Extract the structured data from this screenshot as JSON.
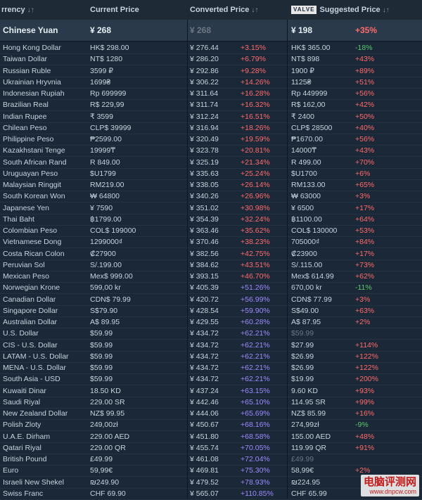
{
  "header": {
    "col_currency": "rrency",
    "col_current": "Current Price",
    "col_converted": "Converted Price",
    "valve_badge": "VALVE",
    "col_suggested": "Suggested Price",
    "sort_glyph": "↓↑"
  },
  "highlight": {
    "currency": "Chinese Yuan",
    "current": "¥ 268",
    "converted": "¥ 268",
    "suggested": "¥ 198",
    "suggested_pct": "+35%"
  },
  "rows": [
    {
      "currency": "Hong Kong Dollar",
      "current": "HK$ 298.00",
      "converted": "¥ 276.44",
      "conv_pct": "+3.15%",
      "suggested": "HK$ 365.00",
      "sugg_pct": "-18%"
    },
    {
      "currency": "Taiwan Dollar",
      "current": "NT$ 1280",
      "converted": "¥ 286.20",
      "conv_pct": "+6.79%",
      "suggested": "NT$ 898",
      "sugg_pct": "+43%"
    },
    {
      "currency": "Russian Ruble",
      "current": "3599 ₽",
      "converted": "¥ 292.86",
      "conv_pct": "+9.28%",
      "suggested": "1900 ₽",
      "sugg_pct": "+89%"
    },
    {
      "currency": "Ukrainian Hryvnia",
      "current": "1699₴",
      "converted": "¥ 306.22",
      "conv_pct": "+14.26%",
      "suggested": "1125₴",
      "sugg_pct": "+51%"
    },
    {
      "currency": "Indonesian Rupiah",
      "current": "Rp 699999",
      "converted": "¥ 311.64",
      "conv_pct": "+16.28%",
      "suggested": "Rp 449999",
      "sugg_pct": "+56%"
    },
    {
      "currency": "Brazilian Real",
      "current": "R$ 229,99",
      "converted": "¥ 311.74",
      "conv_pct": "+16.32%",
      "suggested": "R$ 162,00",
      "sugg_pct": "+42%"
    },
    {
      "currency": "Indian Rupee",
      "current": "₹ 3599",
      "converted": "¥ 312.24",
      "conv_pct": "+16.51%",
      "suggested": "₹ 2400",
      "sugg_pct": "+50%"
    },
    {
      "currency": "Chilean Peso",
      "current": "CLP$ 39999",
      "converted": "¥ 316.94",
      "conv_pct": "+18.26%",
      "suggested": "CLP$ 28500",
      "sugg_pct": "+40%"
    },
    {
      "currency": "Philippine Peso",
      "current": "₱2599.00",
      "converted": "¥ 320.49",
      "conv_pct": "+19.59%",
      "suggested": "₱1670.00",
      "sugg_pct": "+56%"
    },
    {
      "currency": "Kazakhstani Tenge",
      "current": "19999₸",
      "converted": "¥ 323.78",
      "conv_pct": "+20.81%",
      "suggested": "14000₸",
      "sugg_pct": "+43%"
    },
    {
      "currency": "South African Rand",
      "current": "R 849.00",
      "converted": "¥ 325.19",
      "conv_pct": "+21.34%",
      "suggested": "R 499.00",
      "sugg_pct": "+70%"
    },
    {
      "currency": "Uruguayan Peso",
      "current": "$U1799",
      "converted": "¥ 335.63",
      "conv_pct": "+25.24%",
      "suggested": "$U1700",
      "sugg_pct": "+6%"
    },
    {
      "currency": "Malaysian Ringgit",
      "current": "RM219.00",
      "converted": "¥ 338.05",
      "conv_pct": "+26.14%",
      "suggested": "RM133.00",
      "sugg_pct": "+65%"
    },
    {
      "currency": "South Korean Won",
      "current": "₩ 64800",
      "converted": "¥ 340.26",
      "conv_pct": "+26.96%",
      "suggested": "₩ 63000",
      "sugg_pct": "+3%"
    },
    {
      "currency": "Japanese Yen",
      "current": "¥ 7590",
      "converted": "¥ 351.02",
      "conv_pct": "+30.98%",
      "suggested": "¥ 6500",
      "sugg_pct": "+17%"
    },
    {
      "currency": "Thai Baht",
      "current": "฿1799.00",
      "converted": "¥ 354.39",
      "conv_pct": "+32.24%",
      "suggested": "฿1100.00",
      "sugg_pct": "+64%"
    },
    {
      "currency": "Colombian Peso",
      "current": "COL$ 199000",
      "converted": "¥ 363.46",
      "conv_pct": "+35.62%",
      "suggested": "COL$ 130000",
      "sugg_pct": "+53%"
    },
    {
      "currency": "Vietnamese Dong",
      "current": "1299000₫",
      "converted": "¥ 370.46",
      "conv_pct": "+38.23%",
      "suggested": "705000₫",
      "sugg_pct": "+84%"
    },
    {
      "currency": "Costa Rican Colon",
      "current": "₡27900",
      "converted": "¥ 382.56",
      "conv_pct": "+42.75%",
      "suggested": "₡23900",
      "sugg_pct": "+17%"
    },
    {
      "currency": "Peruvian Sol",
      "current": "S/.199.00",
      "converted": "¥ 384.62",
      "conv_pct": "+43.51%",
      "suggested": "S/.115.00",
      "sugg_pct": "+73%"
    },
    {
      "currency": "Mexican Peso",
      "current": "Mex$ 999.00",
      "converted": "¥ 393.15",
      "conv_pct": "+46.70%",
      "suggested": "Mex$ 614.99",
      "sugg_pct": "+62%"
    },
    {
      "currency": "Norwegian Krone",
      "current": "599,00 kr",
      "converted": "¥ 405.39",
      "conv_pct": "+51.26%",
      "suggested": "670,00 kr",
      "sugg_pct": "-11%"
    },
    {
      "currency": "Canadian Dollar",
      "current": "CDN$ 79.99",
      "converted": "¥ 420.72",
      "conv_pct": "+56.99%",
      "suggested": "CDN$ 77.99",
      "sugg_pct": "+3%"
    },
    {
      "currency": "Singapore Dollar",
      "current": "S$79.90",
      "converted": "¥ 428.54",
      "conv_pct": "+59.90%",
      "suggested": "S$49.00",
      "sugg_pct": "+63%"
    },
    {
      "currency": "Australian Dollar",
      "current": "A$ 89.95",
      "converted": "¥ 429.55",
      "conv_pct": "+60.28%",
      "suggested": "A$ 87.95",
      "sugg_pct": "+2%"
    },
    {
      "currency": "U.S. Dollar",
      "current": "$59.99",
      "converted": "¥ 434.72",
      "conv_pct": "+62.21%",
      "suggested": "$59.99",
      "sugg_pct": ""
    },
    {
      "currency": "CIS - U.S. Dollar",
      "current": "$59.99",
      "converted": "¥ 434.72",
      "conv_pct": "+62.21%",
      "suggested": "$27.99",
      "sugg_pct": "+114%"
    },
    {
      "currency": "LATAM - U.S. Dollar",
      "current": "$59.99",
      "converted": "¥ 434.72",
      "conv_pct": "+62.21%",
      "suggested": "$26.99",
      "sugg_pct": "+122%"
    },
    {
      "currency": "MENA - U.S. Dollar",
      "current": "$59.99",
      "converted": "¥ 434.72",
      "conv_pct": "+62.21%",
      "suggested": "$26.99",
      "sugg_pct": "+122%"
    },
    {
      "currency": "South Asia - USD",
      "current": "$59.99",
      "converted": "¥ 434.72",
      "conv_pct": "+62.21%",
      "suggested": "$19.99",
      "sugg_pct": "+200%"
    },
    {
      "currency": "Kuwaiti Dinar",
      "current": "18.50 KD",
      "converted": "¥ 437.24",
      "conv_pct": "+63.15%",
      "suggested": "9.60 KD",
      "sugg_pct": "+93%"
    },
    {
      "currency": "Saudi Riyal",
      "current": "229.00 SR",
      "converted": "¥ 442.46",
      "conv_pct": "+65.10%",
      "suggested": "114.95 SR",
      "sugg_pct": "+99%"
    },
    {
      "currency": "New Zealand Dollar",
      "current": "NZ$ 99.95",
      "converted": "¥ 444.06",
      "conv_pct": "+65.69%",
      "suggested": "NZ$ 85.99",
      "sugg_pct": "+16%"
    },
    {
      "currency": "Polish Zloty",
      "current": "249,00zł",
      "converted": "¥ 450.67",
      "conv_pct": "+68.16%",
      "suggested": "274,99zł",
      "sugg_pct": "-9%"
    },
    {
      "currency": "U.A.E. Dirham",
      "current": "229.00 AED",
      "converted": "¥ 451.80",
      "conv_pct": "+68.58%",
      "suggested": "155.00 AED",
      "sugg_pct": "+48%"
    },
    {
      "currency": "Qatari Riyal",
      "current": "229.00 QR",
      "converted": "¥ 455.74",
      "conv_pct": "+70.05%",
      "suggested": "119.99 QR",
      "sugg_pct": "+91%"
    },
    {
      "currency": "British Pound",
      "current": "£49.99",
      "converted": "¥ 461.08",
      "conv_pct": "+72.04%",
      "suggested": "£49.99",
      "sugg_pct": ""
    },
    {
      "currency": "Euro",
      "current": "59,99€",
      "converted": "¥ 469.81",
      "conv_pct": "+75.30%",
      "suggested": "58,99€",
      "sugg_pct": "+2%"
    },
    {
      "currency": "Israeli New Shekel",
      "current": "₪249.90",
      "converted": "¥ 479.52",
      "conv_pct": "+78.93%",
      "suggested": "₪224.95",
      "sugg_pct": ""
    },
    {
      "currency": "Swiss Franc",
      "current": "CHF 69.90",
      "converted": "¥ 565.07",
      "conv_pct": "+110.85%",
      "suggested": "CHF 65.99",
      "sugg_pct": ""
    }
  ],
  "dim_suggested_rows": [
    25,
    36
  ],
  "watermark": {
    "line1": "电脑评测网",
    "line2": "www.dnpcw.com"
  }
}
